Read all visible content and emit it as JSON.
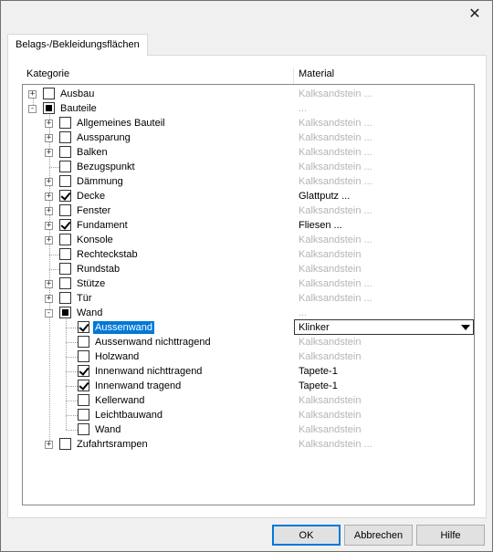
{
  "dialog": {
    "close_glyph": "✕",
    "tab_label": "Belags-/Bekleidungsflächen",
    "columns": {
      "category": "Kategorie",
      "material": "Material"
    }
  },
  "tree": [
    {
      "level": 0,
      "expander": "+",
      "check": "none",
      "label": "Ausbau",
      "material": "Kalksandstein ...",
      "material_active": false
    },
    {
      "level": 0,
      "expander": "-",
      "check": "partial",
      "label": "Bauteile",
      "material": "...",
      "material_active": false
    },
    {
      "level": 1,
      "expander": "+",
      "check": "none",
      "label": "Allgemeines Bauteil",
      "material": "Kalksandstein ...",
      "material_active": false
    },
    {
      "level": 1,
      "expander": "+",
      "check": "none",
      "label": "Aussparung",
      "material": "Kalksandstein ...",
      "material_active": false
    },
    {
      "level": 1,
      "expander": "+",
      "check": "none",
      "label": "Balken",
      "material": "Kalksandstein ...",
      "material_active": false
    },
    {
      "level": 1,
      "expander": "",
      "check": "none",
      "label": "Bezugspunkt",
      "material": "Kalksandstein ...",
      "material_active": false
    },
    {
      "level": 1,
      "expander": "+",
      "check": "none",
      "label": "Dämmung",
      "material": "Kalksandstein ...",
      "material_active": false
    },
    {
      "level": 1,
      "expander": "+",
      "check": "checked",
      "label": "Decke",
      "material": "Glattputz ...",
      "material_active": true
    },
    {
      "level": 1,
      "expander": "+",
      "check": "none",
      "label": "Fenster",
      "material": "Kalksandstein ...",
      "material_active": false
    },
    {
      "level": 1,
      "expander": "+",
      "check": "checked",
      "label": "Fundament",
      "material": "Fliesen ...",
      "material_active": true
    },
    {
      "level": 1,
      "expander": "+",
      "check": "none",
      "label": "Konsole",
      "material": "Kalksandstein ...",
      "material_active": false
    },
    {
      "level": 1,
      "expander": "",
      "check": "none",
      "label": "Rechteckstab",
      "material": "Kalksandstein",
      "material_active": false
    },
    {
      "level": 1,
      "expander": "",
      "check": "none",
      "label": "Rundstab",
      "material": "Kalksandstein",
      "material_active": false
    },
    {
      "level": 1,
      "expander": "+",
      "check": "none",
      "label": "Stütze",
      "material": "Kalksandstein ...",
      "material_active": false
    },
    {
      "level": 1,
      "expander": "+",
      "check": "none",
      "label": "Tür",
      "material": "Kalksandstein ...",
      "material_active": false
    },
    {
      "level": 1,
      "expander": "-",
      "check": "partial",
      "label": "Wand",
      "material": "...",
      "material_active": false
    },
    {
      "level": 2,
      "expander": "",
      "check": "checked",
      "label": "Aussenwand",
      "material": "Klinker",
      "material_active": true,
      "selected": true
    },
    {
      "level": 2,
      "expander": "",
      "check": "none",
      "label": "Aussenwand nichttragend",
      "material": "Kalksandstein",
      "material_active": false
    },
    {
      "level": 2,
      "expander": "",
      "check": "none",
      "label": "Holzwand",
      "material": "Kalksandstein",
      "material_active": false
    },
    {
      "level": 2,
      "expander": "",
      "check": "checked",
      "label": "Innenwand nichttragend",
      "material": "Tapete-1",
      "material_active": true
    },
    {
      "level": 2,
      "expander": "",
      "check": "checked",
      "label": "Innenwand tragend",
      "material": "Tapete-1",
      "material_active": true
    },
    {
      "level": 2,
      "expander": "",
      "check": "none",
      "label": "Kellerwand",
      "material": "Kalksandstein",
      "material_active": false
    },
    {
      "level": 2,
      "expander": "",
      "check": "none",
      "label": "Leichtbauwand",
      "material": "Kalksandstein",
      "material_active": false
    },
    {
      "level": 2,
      "expander": "",
      "check": "none",
      "label": "Wand",
      "material": "Kalksandstein",
      "material_active": false
    },
    {
      "level": 1,
      "expander": "+",
      "check": "none",
      "label": "Zufahrtsrampen",
      "material": "Kalksandstein ...",
      "material_active": false
    }
  ],
  "buttons": {
    "ok": "OK",
    "cancel": "Abbrechen",
    "help": "Hilfe"
  }
}
